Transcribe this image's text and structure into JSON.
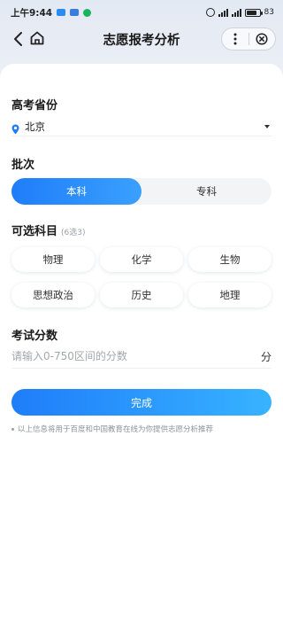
{
  "status_bar": {
    "time": "上午9:44",
    "battery": "83",
    "battery_level": 0.83
  },
  "nav": {
    "title": "志愿报考分析",
    "back_icon": "chevron-left-icon",
    "home_icon": "home-icon",
    "more_icon": "more-vertical-icon",
    "close_icon": "close-circle-icon"
  },
  "province": {
    "label": "高考省份",
    "value": "北京",
    "icon": "location-pin-icon"
  },
  "batch": {
    "label": "批次",
    "options": [
      "本科",
      "专科"
    ],
    "selected": "本科"
  },
  "subjects": {
    "label": "可选科目",
    "hint": "(6选3)",
    "items": [
      "物理",
      "化学",
      "生物",
      "思想政治",
      "历史",
      "地理"
    ]
  },
  "score": {
    "label": "考试分数",
    "placeholder": "请输入0-750区间的分数",
    "value": "",
    "unit": "分"
  },
  "submit_label": "完成",
  "note": "以上信息将用于百度和中国教育在线为你提供志愿分析推荐",
  "colors": {
    "accent": "#1f7dfa",
    "accent_light": "#37b3ff",
    "background": "#e9edf5"
  }
}
